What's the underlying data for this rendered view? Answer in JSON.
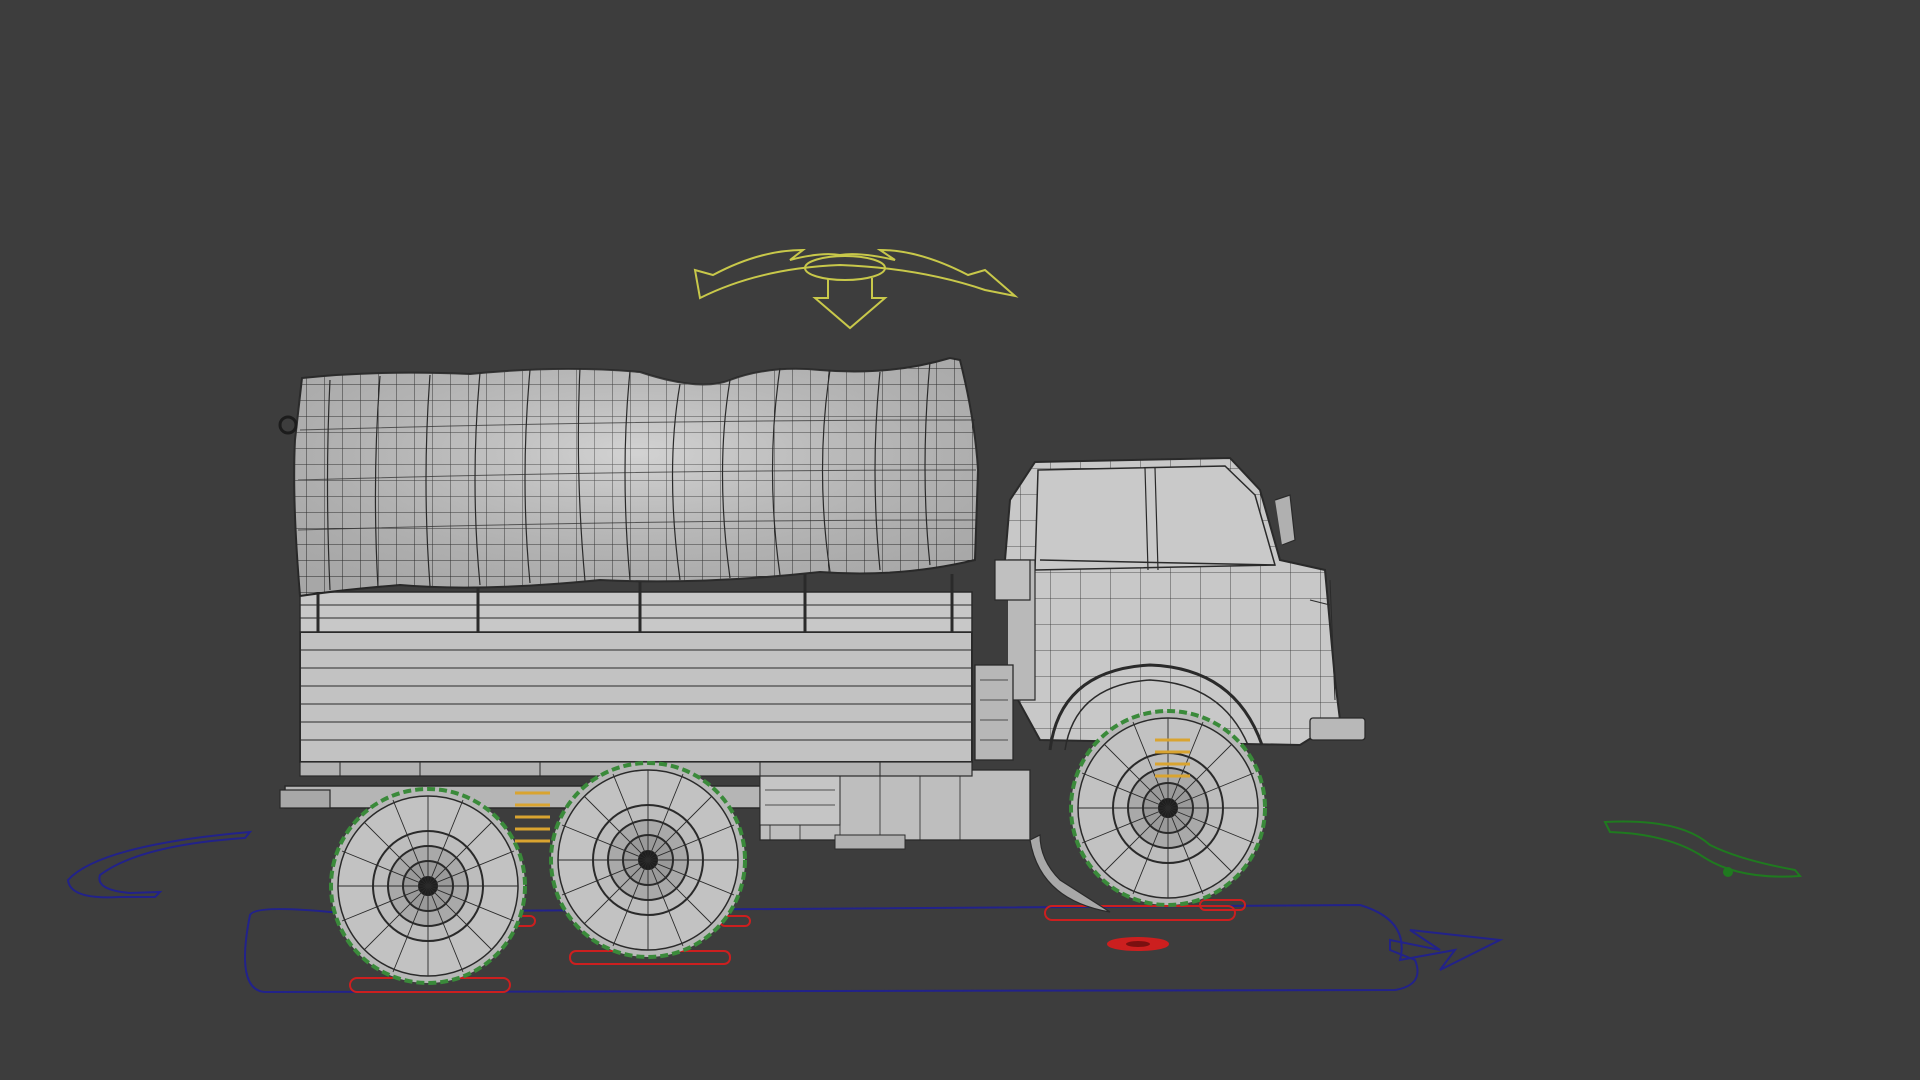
{
  "viewport": {
    "background": "#3d3d3d"
  },
  "colors": {
    "mesh_fill": "#bdbdbd",
    "mesh_fill_light": "#cfcfcf",
    "mesh_fill_dark": "#8f8f8f",
    "wire": "#2a2a2a",
    "tarp_fill": "#c4c4c4",
    "tire_wire": "#3a8a3a",
    "gizmo_top": "#c8c84a",
    "gizmo_blue": "#22228a",
    "gizmo_red": "#cc1f1f",
    "gizmo_green": "#1f7a1f",
    "spring": "#d9a430"
  },
  "scene": {
    "object": "truck-3d-model",
    "view": "side-orthographic",
    "rig_controls": [
      "top-rotate-control",
      "root-move-control",
      "wheel-contact-controls",
      "left-arc-control",
      "right-arc-control"
    ]
  }
}
